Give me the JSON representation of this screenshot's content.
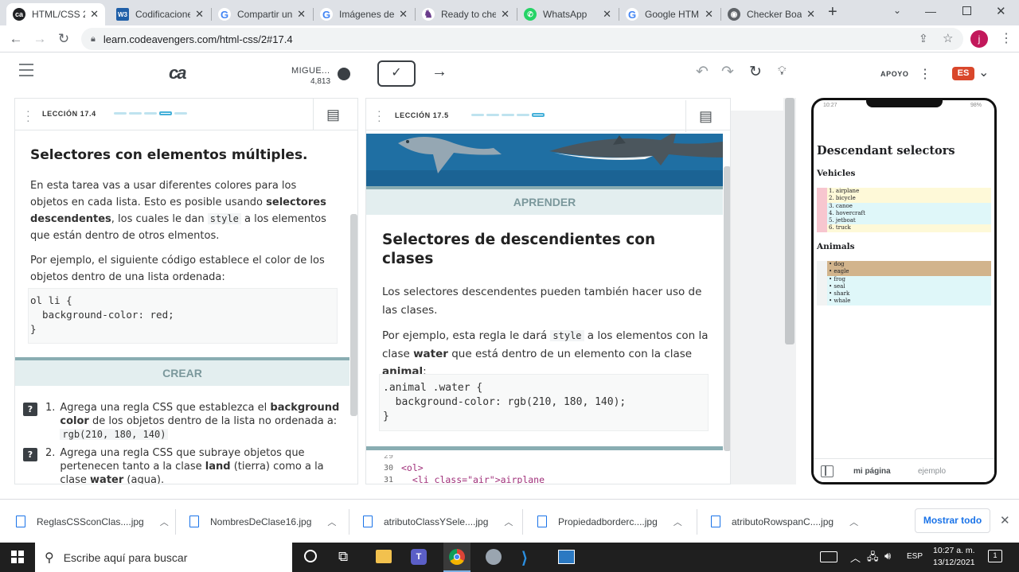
{
  "tabs": [
    {
      "label": "HTML/CSS 2.",
      "favicon_color": "#202124",
      "favicon_glyph": "ca",
      "active": true
    },
    {
      "label": "Codificacione",
      "favicon_color": "#1f5fa8",
      "favicon_glyph": "W3",
      "active": false
    },
    {
      "label": "Compartir un",
      "favicon_color": "#4285f4",
      "favicon_glyph": "G",
      "active": false
    },
    {
      "label": "Imágenes de",
      "favicon_color": "#4285f4",
      "favicon_glyph": "G",
      "active": false
    },
    {
      "label": "Ready to che",
      "favicon_color": "#6a3c8c",
      "favicon_glyph": "♞",
      "active": false
    },
    {
      "label": "WhatsApp",
      "favicon_color": "#25d366",
      "favicon_glyph": "✆",
      "active": false
    },
    {
      "label": "Google HTML",
      "favicon_color": "#4285f4",
      "favicon_glyph": "G",
      "active": false
    },
    {
      "label": "Checker Boar",
      "favicon_color": "#5f6368",
      "favicon_glyph": "◉",
      "active": false
    }
  ],
  "address_bar": {
    "url": "learn.codeavengers.com/html-css/2#17.4"
  },
  "header": {
    "logo": "ca",
    "user_name": "MIGUE...",
    "user_points": "4,813",
    "support_label": "APOYO",
    "lang_label": "ES"
  },
  "left_panel": {
    "lesson_label": "LECCIÓN 17.4",
    "title": "Selectores con elementos múltiples.",
    "para1_a": "En esta tarea vas a usar diferentes colores para los objetos en cada lista. Esto es posible usando ",
    "para1_bold": "selectores descendentes",
    "para1_b": ", los cuales le dan ",
    "para1_code": "style",
    "para1_c": " a los elementos que están dentro de otros elmentos.",
    "para2": "Por ejemplo, el siguiente código establece el color de los objetos dentro de una lista ordenada:",
    "code": "ol li {\n  background-color: red;\n}",
    "strip_label": "CREAR",
    "tasks": [
      {
        "num": "1.",
        "a": "Agrega una regla CSS que establezca el ",
        "b": "background color",
        "c": " de los objetos dentro de la lista no ordenada a: ",
        "code": "rgb(210, 180, 140)"
      },
      {
        "num": "2.",
        "a": "Agrega una regla CSS que subraye objetos que pertenecen tanto a la clase ",
        "b": "land",
        "c": " (tierra) como a la clase ",
        "d": "water",
        "e": " (agua)."
      }
    ]
  },
  "mid_panel": {
    "lesson_label": "LECCIÓN 17.5",
    "strip_label": "APRENDER",
    "title": "Selectores de descendientes con clases",
    "para1": "Los selectores descendentes pueden también hacer uso de las clases.",
    "para2_a": "Por ejemplo, esta regla le dará ",
    "para2_code": "style",
    "para2_b": " a los elementos con la clase ",
    "para2_bold1": "water",
    "para2_c": " que está dentro de un elemento con la clase ",
    "para2_bold2": "animal",
    "para2_d": ":",
    "code": ".animal .water {\n  background-color: rgb(210, 180, 140);\n}",
    "editor_lines": [
      {
        "num": "29",
        "text": ""
      },
      {
        "num": "30",
        "text": "<ol>"
      },
      {
        "num": "31",
        "text": "  <li class=\"air\">airplane"
      }
    ]
  },
  "phone": {
    "time": "10:27",
    "battery": "98%",
    "h1": "Descendant selectors",
    "vehicles_title": "Vehicles",
    "vehicles": [
      "airplane",
      "bicycle",
      "canoe",
      "hovercraft",
      "jetboat",
      "truck"
    ],
    "animals_title": "Animals",
    "animals": [
      "dog",
      "eagle",
      "frog",
      "seal",
      "shark",
      "whale"
    ],
    "tab_mine": "mi página",
    "tab_example": "ejemplo"
  },
  "downloads": [
    {
      "name": "ReglasCSSconClas....jpg"
    },
    {
      "name": "NombresDeClase16.jpg"
    },
    {
      "name": "atributoClassYSele....jpg"
    },
    {
      "name": "Propiedadborderc....jpg"
    },
    {
      "name": "atributoRowspanC....jpg"
    }
  ],
  "downloads_show_all": "Mostrar todo",
  "taskbar": {
    "search_placeholder": "Escribe aquí para buscar",
    "lang": "ESP",
    "time": "10:27 a. m.",
    "date": "13/12/2021",
    "notif_count": "1"
  },
  "colors": {
    "accent": "#45b0d9",
    "strip_bg": "#e3eeef",
    "brand_red": "#d9472b",
    "ocean": "#1f6fa3",
    "pink": "#f7c6cf",
    "yellow": "#fef9d8",
    "cyan": "#dff7f9",
    "tan": "#d2b48c"
  }
}
